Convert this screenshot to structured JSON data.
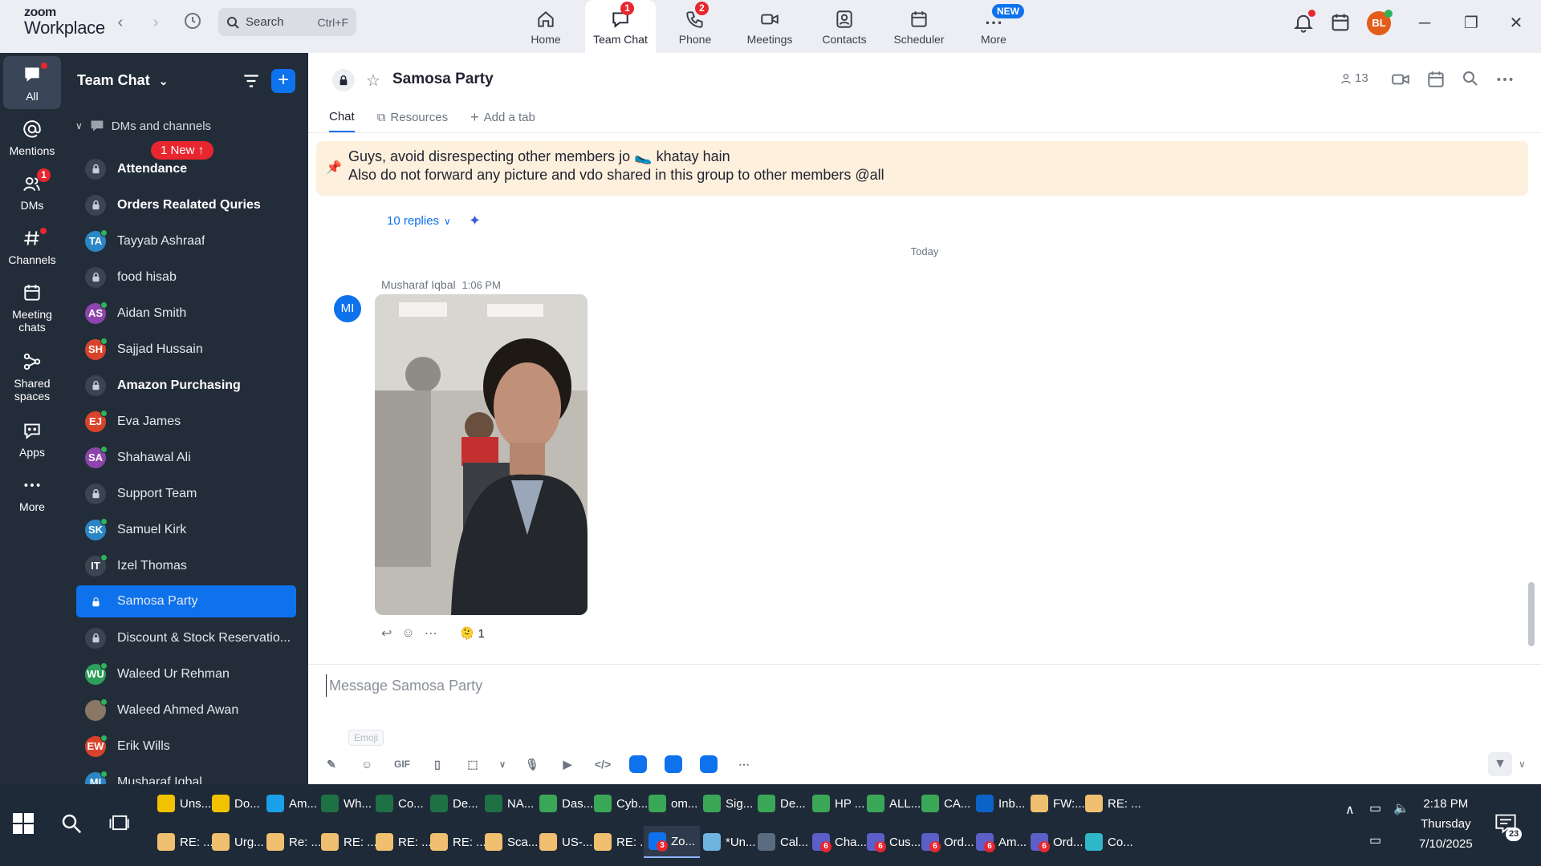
{
  "app": {
    "logo_line1": "zoom",
    "logo_line2": "Workplace",
    "search_label": "Search",
    "search_shortcut": "Ctrl+F",
    "user_initials": "BL",
    "nav_tabs": [
      {
        "label": "Home",
        "icon": "home-icon"
      },
      {
        "label": "Team Chat",
        "icon": "chat-icon",
        "badge": "1",
        "active": true
      },
      {
        "label": "Phone",
        "icon": "phone-icon",
        "badge": "2"
      },
      {
        "label": "Meetings",
        "icon": "video-icon"
      },
      {
        "label": "Contacts",
        "icon": "contacts-icon"
      },
      {
        "label": "Scheduler",
        "icon": "calendar-icon"
      },
      {
        "label": "More",
        "icon": "more-icon",
        "pill": "NEW"
      }
    ]
  },
  "rail": {
    "items": [
      {
        "label": "All",
        "icon": "chat-bubble-icon"
      },
      {
        "label": "Mentions",
        "icon": "at-icon"
      },
      {
        "label": "DMs",
        "icon": "people-icon",
        "badge": "1"
      },
      {
        "label": "Channels",
        "icon": "hash-icon"
      },
      {
        "label": "Meeting chats",
        "icon": "calendar-icon"
      },
      {
        "label": "Shared spaces",
        "icon": "share-icon"
      },
      {
        "label": "Apps",
        "icon": "apps-icon"
      },
      {
        "label": "More",
        "icon": "ellipsis-icon"
      }
    ]
  },
  "sidebar": {
    "title": "Team Chat",
    "section": "DMs and channels",
    "new_badge": "1 New ↑",
    "chats": [
      {
        "name": "Attendance",
        "type": "lock",
        "bold": true
      },
      {
        "name": "Orders Realated Quries",
        "type": "lock",
        "bold": true
      },
      {
        "name": "Tayyab Ashraaf",
        "initials": "TA",
        "color": "#2b86c5"
      },
      {
        "name": "food hisab",
        "type": "lock"
      },
      {
        "name": "Aidan Smith",
        "initials": "AS",
        "color": "#8e44ad"
      },
      {
        "name": "Sajjad Hussain",
        "initials": "SH",
        "color": "#d9432b"
      },
      {
        "name": "Amazon Purchasing",
        "type": "lock",
        "bold": true
      },
      {
        "name": "Eva James",
        "initials": "EJ",
        "color": "#d9432b"
      },
      {
        "name": "Shahawal Ali",
        "initials": "SA",
        "color": "#8e44ad"
      },
      {
        "name": "Support Team",
        "type": "lock"
      },
      {
        "name": "Samuel Kirk",
        "initials": "SK",
        "color": "#2b86c5"
      },
      {
        "name": "Izel Thomas",
        "initials": "IT",
        "color": "#3a4452"
      },
      {
        "name": "Samosa Party",
        "type": "lock",
        "selected": true
      },
      {
        "name": "Discount & Stock Reservatio...",
        "type": "lock"
      },
      {
        "name": "Waleed Ur Rehman",
        "initials": "WU",
        "color": "#2e9e5b"
      },
      {
        "name": "Waleed Ahmed Awan",
        "initials": "",
        "color": "#8a7765"
      },
      {
        "name": "Erik Wills",
        "initials": "EW",
        "color": "#d9432b"
      },
      {
        "name": "Musharaf Iqbal",
        "initials": "MI",
        "color": "#2b86c5"
      }
    ]
  },
  "channel": {
    "title": "Samosa Party",
    "members": "13",
    "tabs": [
      "Chat",
      "Resources",
      "Add a tab"
    ],
    "pinned_line1": "Guys, avoid disrespecting other members jo 🥿 khatay hain",
    "pinned_line2": "Also do not forward any picture and vdo shared in this group to other members @all",
    "replies": "10 replies",
    "date_divider": "Today",
    "message": {
      "author": "Musharaf Iqbal",
      "time": "1:06 PM",
      "initials": "MI",
      "reaction_emoji": "🫠",
      "reaction_count": "1"
    },
    "composer_placeholder": "Message Samosa Party",
    "tooltip": "Emoji"
  },
  "taskbar": {
    "row1": [
      {
        "label": "Uns...",
        "color": "#f2c200"
      },
      {
        "label": "Do...",
        "color": "#f2c200"
      },
      {
        "label": "Am...",
        "color": "#1aa0e8"
      },
      {
        "label": "Wh...",
        "color": "#1e7145"
      },
      {
        "label": "Co...",
        "color": "#1e7145"
      },
      {
        "label": "De...",
        "color": "#1e7145"
      },
      {
        "label": "NA...",
        "color": "#1e7145"
      },
      {
        "label": "Das...",
        "color": "#3aa757"
      },
      {
        "label": "Cyb...",
        "color": "#3aa757"
      },
      {
        "label": "om...",
        "color": "#3aa757"
      },
      {
        "label": "Sig...",
        "color": "#3aa757"
      },
      {
        "label": "De...",
        "color": "#3aa757"
      },
      {
        "label": "HP ...",
        "color": "#3aa757"
      },
      {
        "label": "ALL...",
        "color": "#3aa757"
      },
      {
        "label": "CA...",
        "color": "#3aa757"
      },
      {
        "label": "Inb...",
        "color": "#0a64c8"
      },
      {
        "label": "FW:...",
        "color": "#f0c070"
      },
      {
        "label": "RE: ...",
        "color": "#f0c070"
      }
    ],
    "row2": [
      {
        "label": "RE: ...",
        "color": "#f0c070"
      },
      {
        "label": "Urg...",
        "color": "#f0c070"
      },
      {
        "label": "Re: ...",
        "color": "#f0c070"
      },
      {
        "label": "RE: ...",
        "color": "#f0c070"
      },
      {
        "label": "RE: ...",
        "color": "#f0c070"
      },
      {
        "label": "RE: ...",
        "color": "#f0c070"
      },
      {
        "label": "Sca...",
        "color": "#f0c070"
      },
      {
        "label": "US-...",
        "color": "#f0c070"
      },
      {
        "label": "RE: ...",
        "color": "#f0c070"
      },
      {
        "label": "Zo...",
        "color": "#0e72ed",
        "badge": "3",
        "active": true
      },
      {
        "label": "*Un...",
        "color": "#6fb3e0"
      },
      {
        "label": "Cal...",
        "color": "#5a6c80"
      },
      {
        "label": "Cha...",
        "color": "#5b5fc7",
        "badge": "6"
      },
      {
        "label": "Cus...",
        "color": "#5b5fc7",
        "badge": "6"
      },
      {
        "label": "Ord...",
        "color": "#5b5fc7",
        "badge": "6"
      },
      {
        "label": "Am...",
        "color": "#5b5fc7",
        "badge": "6"
      },
      {
        "label": "Ord...",
        "color": "#5b5fc7",
        "badge": "6"
      },
      {
        "label": "Co...",
        "color": "#2fb6c9"
      }
    ],
    "time": "2:18 PM",
    "day": "Thursday",
    "date": "7/10/2025",
    "notif_count": "23"
  }
}
